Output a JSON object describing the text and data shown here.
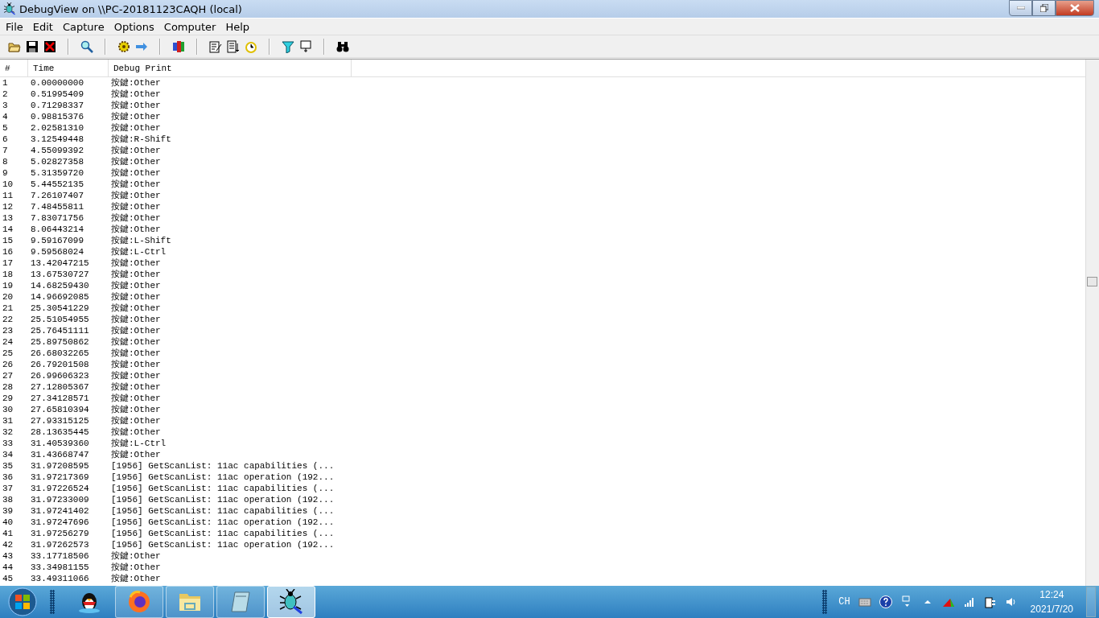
{
  "window": {
    "title": "DebugView on \\\\PC-20181123CAQH (local)"
  },
  "menu": [
    "File",
    "Edit",
    "Capture",
    "Options",
    "Computer",
    "Help"
  ],
  "table": {
    "columns": [
      "#",
      "Time",
      "Debug Print"
    ],
    "rows": [
      [
        "1",
        "0.00000000",
        "按鍵:Other"
      ],
      [
        "2",
        "0.51995409",
        "按鍵:Other"
      ],
      [
        "3",
        "0.71298337",
        "按鍵:Other"
      ],
      [
        "4",
        "0.98815376",
        "按鍵:Other"
      ],
      [
        "5",
        "2.02581310",
        "按鍵:Other"
      ],
      [
        "6",
        "3.12549448",
        "按鍵:R-Shift"
      ],
      [
        "7",
        "4.55099392",
        "按鍵:Other"
      ],
      [
        "8",
        "5.02827358",
        "按鍵:Other"
      ],
      [
        "9",
        "5.31359720",
        "按鍵:Other"
      ],
      [
        "10",
        "5.44552135",
        "按鍵:Other"
      ],
      [
        "11",
        "7.26107407",
        "按鍵:Other"
      ],
      [
        "12",
        "7.48455811",
        "按鍵:Other"
      ],
      [
        "13",
        "7.83071756",
        "按鍵:Other"
      ],
      [
        "14",
        "8.06443214",
        "按鍵:Other"
      ],
      [
        "15",
        "9.59167099",
        "按鍵:L-Shift"
      ],
      [
        "16",
        "9.59568024",
        "按鍵:L-Ctrl"
      ],
      [
        "17",
        "13.42047215",
        "按鍵:Other"
      ],
      [
        "18",
        "13.67530727",
        "按鍵:Other"
      ],
      [
        "19",
        "14.68259430",
        "按鍵:Other"
      ],
      [
        "20",
        "14.96692085",
        "按鍵:Other"
      ],
      [
        "21",
        "25.30541229",
        "按鍵:Other"
      ],
      [
        "22",
        "25.51054955",
        "按鍵:Other"
      ],
      [
        "23",
        "25.76451111",
        "按鍵:Other"
      ],
      [
        "24",
        "25.89750862",
        "按鍵:Other"
      ],
      [
        "25",
        "26.68032265",
        "按鍵:Other"
      ],
      [
        "26",
        "26.79201508",
        "按鍵:Other"
      ],
      [
        "27",
        "26.99606323",
        "按鍵:Other"
      ],
      [
        "28",
        "27.12805367",
        "按鍵:Other"
      ],
      [
        "29",
        "27.34128571",
        "按鍵:Other"
      ],
      [
        "30",
        "27.65810394",
        "按鍵:Other"
      ],
      [
        "31",
        "27.93315125",
        "按鍵:Other"
      ],
      [
        "32",
        "28.13635445",
        "按鍵:Other"
      ],
      [
        "33",
        "31.40539360",
        "按鍵:L-Ctrl"
      ],
      [
        "34",
        "31.43668747",
        "按鍵:Other"
      ],
      [
        "35",
        "31.97208595",
        "[1956] GetScanList: 11ac capabilities (..."
      ],
      [
        "36",
        "31.97217369",
        "[1956] GetScanList: 11ac operation (192..."
      ],
      [
        "37",
        "31.97226524",
        "[1956] GetScanList: 11ac capabilities (..."
      ],
      [
        "38",
        "31.97233009",
        "[1956] GetScanList: 11ac operation (192..."
      ],
      [
        "39",
        "31.97241402",
        "[1956] GetScanList: 11ac capabilities (..."
      ],
      [
        "40",
        "31.97247696",
        "[1956] GetScanList: 11ac operation (192..."
      ],
      [
        "41",
        "31.97256279",
        "[1956] GetScanList: 11ac capabilities (..."
      ],
      [
        "42",
        "31.97262573",
        "[1956] GetScanList: 11ac operation (192..."
      ],
      [
        "43",
        "33.17718506",
        "按鍵:Other"
      ],
      [
        "44",
        "33.34981155",
        "按鍵:Other"
      ],
      [
        "45",
        "33.49311066",
        "按鍵:Other"
      ]
    ]
  },
  "taskbar": {
    "apps": [
      {
        "kind": "penguin",
        "selected": false
      },
      {
        "kind": "firefox",
        "selected": false
      },
      {
        "kind": "folder",
        "selected": false
      },
      {
        "kind": "notepad",
        "selected": false
      },
      {
        "kind": "bug",
        "selected": true
      }
    ],
    "language": "CH",
    "time": "12:24",
    "date": "2021/7/20"
  }
}
